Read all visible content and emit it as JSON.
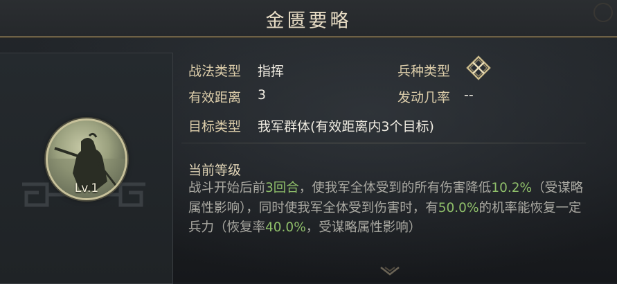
{
  "window": {
    "title": "金匮要略"
  },
  "portrait": {
    "level_label": "Lv.1"
  },
  "info": {
    "tactic_type": {
      "label": "战法类型",
      "value": "指挥"
    },
    "troop_type": {
      "label": "兵种类型",
      "icon": "crossed-weapons-icon"
    },
    "range": {
      "label": "有效距离",
      "value": "3"
    },
    "trigger_rate": {
      "label": "发动几率",
      "value": "--"
    },
    "target_type": {
      "label": "目标类型",
      "value": "我军群体(有效距离内3个目标)"
    }
  },
  "level_section": {
    "heading": "当前等级",
    "desc": {
      "p1": "战斗开始后前",
      "h1": "3回合",
      "p2": "，使我军全体受到的所有伤害降低",
      "h2": "10.2%",
      "p3": "（受谋略属性影响），同时使我军全体受到伤害时，有",
      "h3": "50.0%",
      "p4": "的机率能恢复一定兵力（恢复率",
      "h4": "40.0%",
      "p5": "，受谋略属性影响）"
    }
  },
  "colors": {
    "highlight": "#8fbf6a",
    "label": "#dccdaa",
    "title": "#e7dcc4"
  }
}
